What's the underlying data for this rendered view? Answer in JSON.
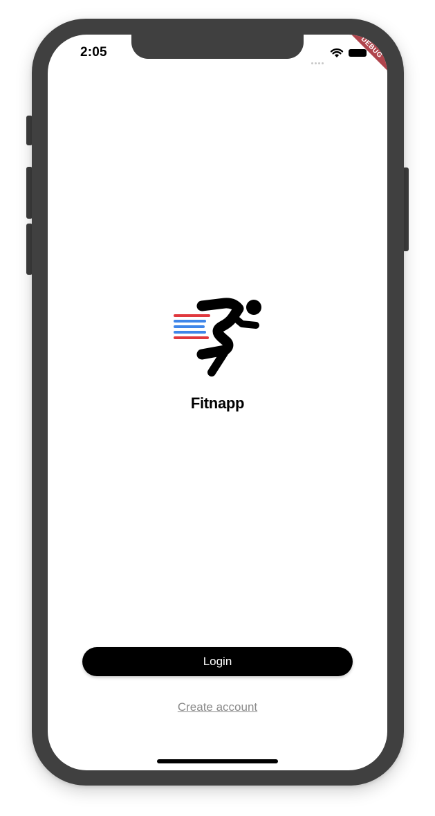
{
  "status_bar": {
    "time": "2:05",
    "signal_icon": "signal-dots-icon",
    "wifi_icon": "wifi-icon",
    "battery_icon": "battery-icon"
  },
  "debug_banner": {
    "label": "DEBUG",
    "color": "#b0454d"
  },
  "app": {
    "logo_icon": "running-man-icon",
    "name": "Fitnapp",
    "speed_line_colors": [
      "#e0383e",
      "#3f86e9"
    ]
  },
  "actions": {
    "login_label": "Login",
    "create_account_label": "Create account"
  }
}
